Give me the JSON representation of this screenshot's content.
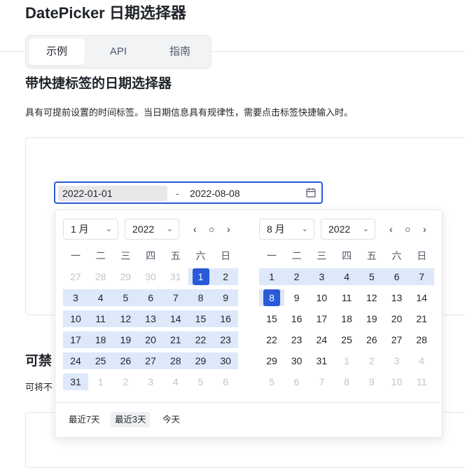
{
  "page": {
    "title": "DatePicker 日期选择器"
  },
  "tabs": [
    {
      "label": "示例"
    },
    {
      "label": "API"
    },
    {
      "label": "指南"
    }
  ],
  "section1": {
    "heading": "带快捷标签的日期选择器",
    "description": "具有可提前设置的时间标签。当日期信息具有规律性，需要点击标签快捷输入时。"
  },
  "range_input": {
    "start": "2022-01-01",
    "separator": "-",
    "end": "2022-08-08",
    "icon": "calendar-icon"
  },
  "left_panel": {
    "month": "1 月",
    "year": "2022",
    "nav": {
      "prev": "‹",
      "today": "○",
      "next": "›"
    },
    "weekdays": [
      "一",
      "二",
      "三",
      "四",
      "五",
      "六",
      "日"
    ],
    "weeks": [
      [
        "27",
        "28",
        "29",
        "30",
        "31",
        "1",
        "2"
      ],
      [
        "3",
        "4",
        "5",
        "6",
        "7",
        "8",
        "9"
      ],
      [
        "10",
        "11",
        "12",
        "13",
        "14",
        "15",
        "16"
      ],
      [
        "17",
        "18",
        "19",
        "20",
        "21",
        "22",
        "23"
      ],
      [
        "24",
        "25",
        "26",
        "27",
        "28",
        "29",
        "30"
      ],
      [
        "31",
        "1",
        "2",
        "3",
        "4",
        "5",
        "6"
      ]
    ]
  },
  "right_panel": {
    "month": "8 月",
    "year": "2022",
    "nav": {
      "prev": "‹",
      "today": "○",
      "next": "›"
    },
    "weekdays": [
      "一",
      "二",
      "三",
      "四",
      "五",
      "六",
      "日"
    ],
    "weeks": [
      [
        "1",
        "2",
        "3",
        "4",
        "5",
        "6",
        "7"
      ],
      [
        "8",
        "9",
        "10",
        "11",
        "12",
        "13",
        "14"
      ],
      [
        "15",
        "16",
        "17",
        "18",
        "19",
        "20",
        "21"
      ],
      [
        "22",
        "23",
        "24",
        "25",
        "26",
        "27",
        "28"
      ],
      [
        "29",
        "30",
        "31",
        "1",
        "2",
        "3",
        "4"
      ],
      [
        "5",
        "6",
        "7",
        "8",
        "9",
        "10",
        "11"
      ]
    ]
  },
  "shortcuts": [
    {
      "label": "最近7天"
    },
    {
      "label": "最近3天"
    },
    {
      "label": "今天"
    }
  ],
  "section2": {
    "heading_partial": "可禁",
    "description_partial": "可将不"
  },
  "colors": {
    "accent": "#2a5ad8",
    "range_band": "#dde8fa"
  }
}
